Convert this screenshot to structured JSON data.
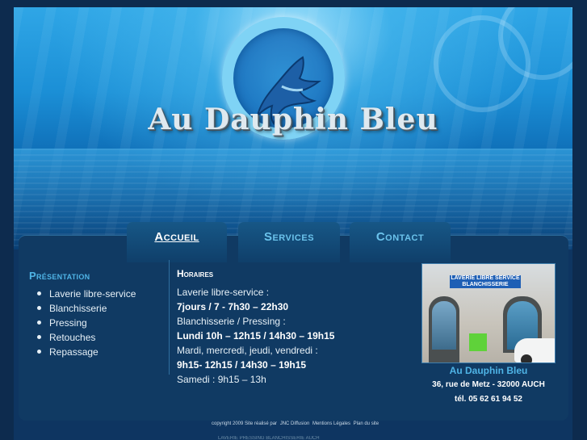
{
  "banner": {
    "logo_text": "Au Dauphin Bleu"
  },
  "nav": {
    "tabs": [
      {
        "label": "Accueil",
        "active": true
      },
      {
        "label": "Services",
        "active": false
      },
      {
        "label": "Contact",
        "active": false
      }
    ]
  },
  "presentation": {
    "title": "Présentation",
    "items": [
      "Laverie libre-service",
      "Blanchisserie",
      "Pressing",
      "Retouches",
      "Repassage"
    ]
  },
  "hours": {
    "title": "Horaires",
    "lines": [
      {
        "text": "Laverie libre-service :",
        "bold": false
      },
      {
        "text": "7jours / 7 - 7h30 – 22h30",
        "bold": true
      },
      {
        "text": "Blanchisserie / Pressing :",
        "bold": false
      },
      {
        "text": "Lundi 10h – 12h15 / 14h30 – 19h15",
        "bold": true
      },
      {
        "text": "Mardi, mercredi, jeudi, vendredi :",
        "bold": false
      },
      {
        "text": "9h15- 12h15 / 14h30 – 19h15",
        "bold": true
      },
      {
        "text": "Samedi : 9h15 – 13h",
        "bold": false
      }
    ]
  },
  "shop": {
    "photo_sign": "LAVERIE LIBRE SERVICE BLANCHISSERIE",
    "name": "Au Dauphin Bleu",
    "address": "36, rue de Metz - 32000 AUCH",
    "phone": "tél. 05 62 61 94 52"
  },
  "footer": {
    "copyright": "copyright 2009 Site réalisé par",
    "links": [
      "JNC Diffusion",
      "Mentions Légales",
      "Plan du site"
    ],
    "line2": "LAVERIE PRESSING BLANCHISSERIE AUCH"
  },
  "colors": {
    "accent": "#4fb4e6",
    "panel": "#103a63",
    "background": "#0d2b4e"
  }
}
